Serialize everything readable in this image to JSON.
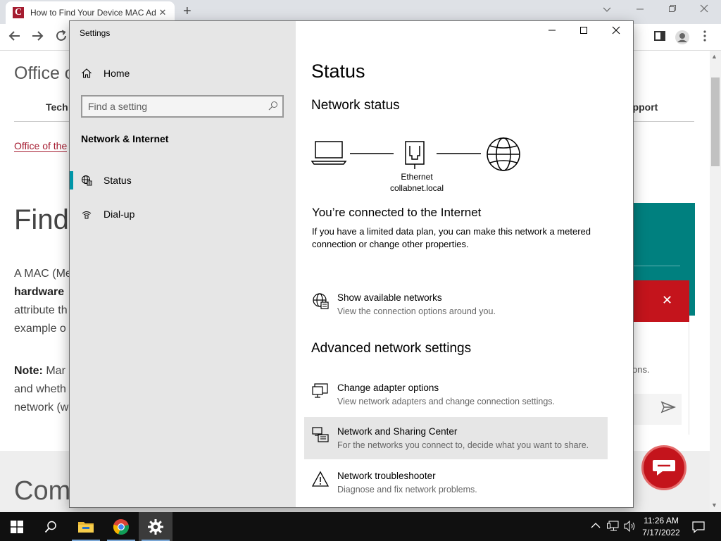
{
  "browser": {
    "tab_title": "How to Find Your Device MAC Ad",
    "tab_close": "✕",
    "new_tab": "+",
    "favicon_letter": "C"
  },
  "webpage": {
    "site_title": "Office o",
    "nav_tech": "Tech",
    "nav_support": "upport",
    "breadcrumb": "Office of the",
    "heading": "Find",
    "para1_line1": "A MAC (Me",
    "para1_line2": "hardware",
    "para1_line3": "attribute th",
    "para1_line4": "example o",
    "note_label": "Note:",
    "note_line1": " Mar",
    "note_line2": "and wheth",
    "note_line3": "network (w",
    "bottom_heading": "Com",
    "chat_snippet": "ons."
  },
  "settings": {
    "window_title": "Settings",
    "home_label": "Home",
    "search_placeholder": "Find a setting",
    "section_title": "Network & Internet",
    "nav_items": [
      {
        "label": "Status",
        "icon": "globe-icon",
        "selected": true
      },
      {
        "label": "Dial-up",
        "icon": "dialup-icon",
        "selected": false
      }
    ],
    "page_title": "Status",
    "network_status_heading": "Network status",
    "ethernet_label": "Ethernet",
    "domain_label": "collabnet.local",
    "connected_title": "You’re connected to the Internet",
    "connected_desc": "If you have a limited data plan, you can make this network a metered connection or change other properties.",
    "show_networks": {
      "title": "Show available networks",
      "subtitle": "View the connection options around you."
    },
    "advanced_heading": "Advanced network settings",
    "adapter": {
      "title": "Change adapter options",
      "subtitle": "View network adapters and change connection settings."
    },
    "sharing": {
      "title": "Network and Sharing Center",
      "subtitle": "For the networks you connect to, decide what you want to share."
    },
    "troubleshooter": {
      "title": "Network troubleshooter",
      "subtitle": "Diagnose and fix network problems."
    }
  },
  "taskbar": {
    "time": "11:26 AM",
    "date": "7/17/2022",
    "apps": [
      "start-icon",
      "search-icon",
      "file-explorer-icon",
      "chrome-icon",
      "settings-gear-icon"
    ]
  },
  "colors": {
    "accent": "#0096a8",
    "brand_red": "#a51c30",
    "teal": "#00807f"
  }
}
